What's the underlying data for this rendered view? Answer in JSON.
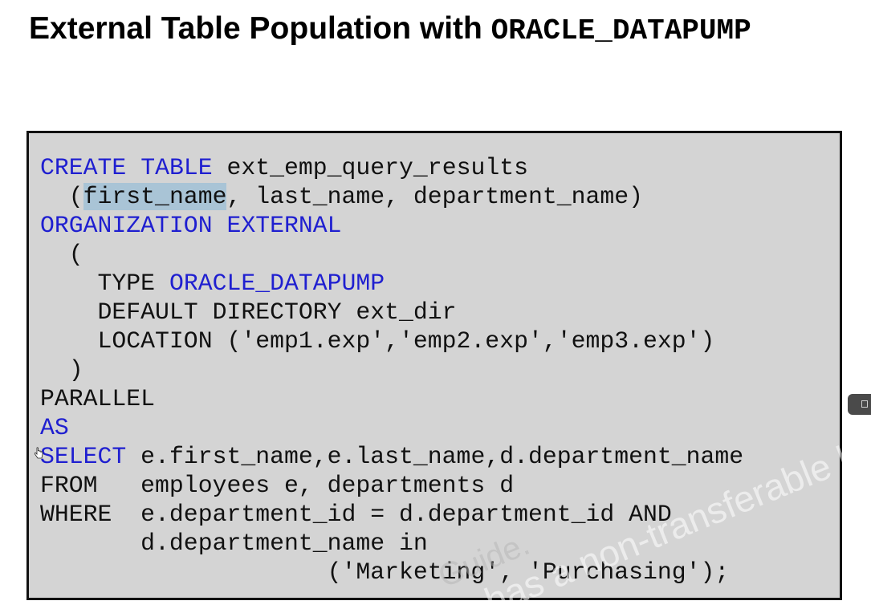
{
  "title": {
    "text": "External Table Population with ",
    "code": "ORACLE_DATAPUMP"
  },
  "code_lines": [
    [
      {
        "t": "CREATE",
        "kw": true
      },
      {
        "t": " "
      },
      {
        "t": "TABLE",
        "kw": true
      },
      {
        "t": " ext_emp_query_results"
      }
    ],
    [
      {
        "t": "  ("
      },
      {
        "t": "first_name",
        "hl": true
      },
      {
        "t": ", last_name, department_name)"
      }
    ],
    [
      {
        "t": "ORGANIZATION",
        "kw": true
      },
      {
        "t": " "
      },
      {
        "t": "EXTERNAL",
        "kw": true
      }
    ],
    [
      {
        "t": "  ("
      }
    ],
    [
      {
        "t": "    TYPE "
      },
      {
        "t": "ORACLE_DATAPUMP",
        "kw": true
      }
    ],
    [
      {
        "t": "    DEFAULT DIRECTORY ext_dir"
      }
    ],
    [
      {
        "t": "    LOCATION ('emp1.exp','emp2.exp','emp3.exp')"
      }
    ],
    [
      {
        "t": "  )"
      }
    ],
    [
      {
        "t": "PARALLEL"
      }
    ],
    [
      {
        "t": "AS",
        "kw": true
      }
    ],
    [
      {
        "t": "SELECT",
        "kw": true
      },
      {
        "t": " e.first_name,e.last_name,d.department_name"
      }
    ],
    [
      {
        "t": "FROM   employees e, departments d"
      }
    ],
    [
      {
        "t": "WHERE  e.department_id = d.department_id AND"
      }
    ],
    [
      {
        "t": "       d.department_name in"
      }
    ],
    [
      {
        "t": "                    ('Marketing', 'Purchasing');"
      }
    ]
  ],
  "watermark": {
    "line1": "has a non-transferable lice",
    "line2": "Guide."
  },
  "colors": {
    "keyword": "#1f1fd0",
    "code_background": "#d4d4d4",
    "highlight": "#a9c4d6",
    "text": "#111111"
  },
  "icons": {
    "cursor": "hand-cursor-icon",
    "side_tab": "panel-toggle-icon"
  }
}
